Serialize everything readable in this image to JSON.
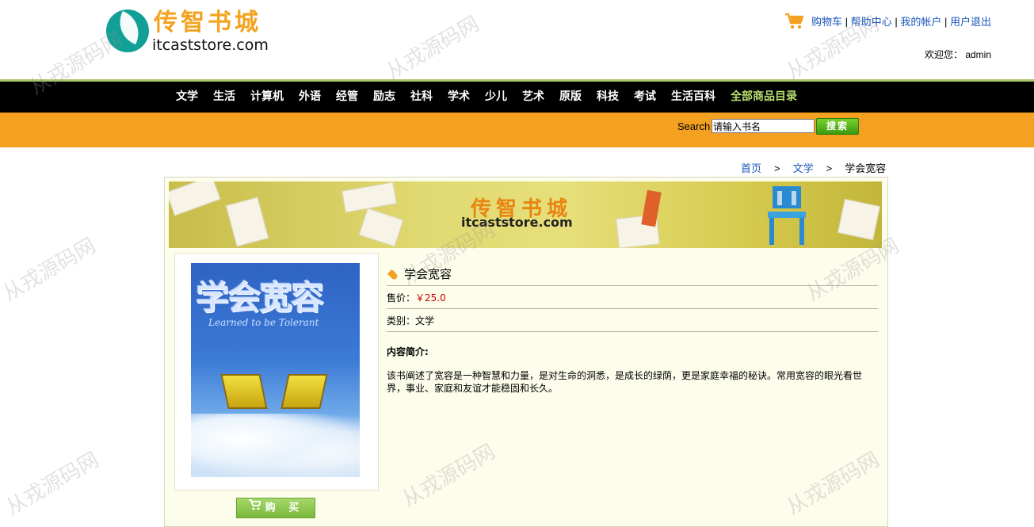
{
  "logo": {
    "cn": "传智书城",
    "en": "itcaststore.com"
  },
  "toplinks": [
    {
      "label": "购物车"
    },
    {
      "label": "帮助中心"
    },
    {
      "label": "我的帐户"
    },
    {
      "label": "用户退出"
    }
  ],
  "toplinks_sep": "|",
  "welcome": {
    "prefix": "欢迎您：",
    "user": "admin"
  },
  "nav": [
    "文学",
    "生活",
    "计算机",
    "外语",
    "经管",
    "励志",
    "社科",
    "学术",
    "少儿",
    "艺术",
    "原版",
    "科技",
    "考试",
    "生活百科"
  ],
  "nav_all": "全部商品目录",
  "search": {
    "label": "Search",
    "value": "请输入书名",
    "button": "搜索"
  },
  "breadcrumb": {
    "home": "首页",
    "category": "文学",
    "current": "学会宽容",
    "sep": ">"
  },
  "banner": {
    "cn": "传智书城",
    "en": "itcaststore.com"
  },
  "book": {
    "cover_title": "学会宽容",
    "cover_subtitle": "Learned to be Tolerant",
    "title": "学会宽容",
    "price_label": "售价：",
    "price": "￥25.0",
    "category_label": "类别：",
    "category": "文学",
    "desc_label": "内容简介:",
    "description": "该书阐述了宽容是一种智慧和力量，是对生命的洞悉，是成长的绿荫，更是家庭幸福的秘诀。常用宽容的眼光看世界，事业、家庭和友谊才能稳固和长久。",
    "buy_label": "购 买"
  },
  "watermark": "从戎源码网",
  "colors": {
    "nav_bg": "#000000",
    "search_bg": "#f4a020",
    "link": "#1a55b8",
    "price": "#cc0000",
    "accent_green": "#a9c56a"
  }
}
